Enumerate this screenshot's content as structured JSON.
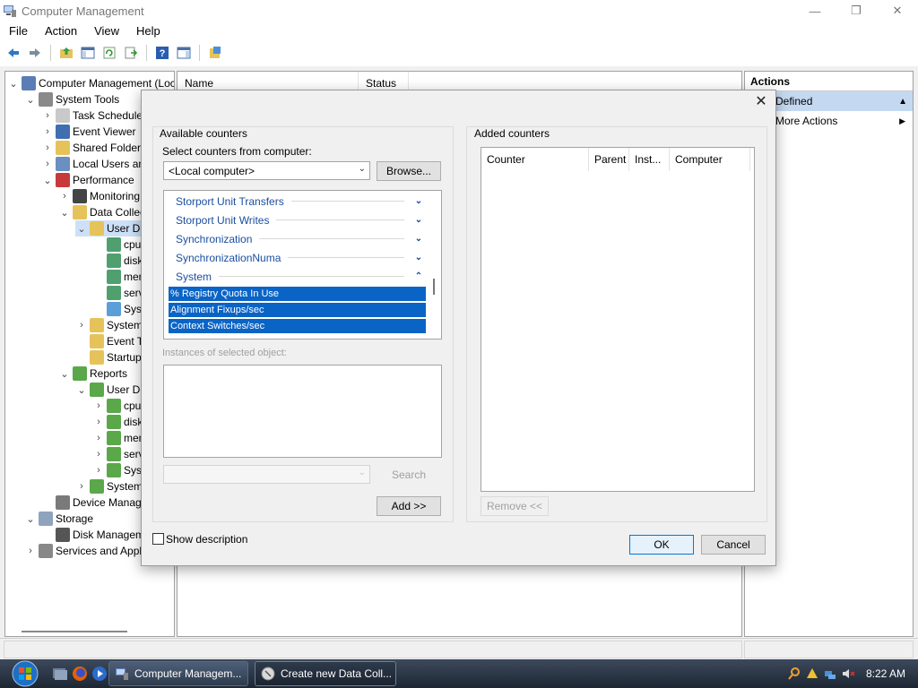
{
  "window": {
    "title": "Computer Management"
  },
  "menubar": [
    "File",
    "Action",
    "View",
    "Help"
  ],
  "toolbar": {
    "buttons": [
      "back-arrow-icon",
      "forward-arrow-icon",
      "up-folder-icon",
      "show-hide-console-tree-icon",
      "refresh-icon",
      "export-list-icon",
      "help-icon",
      "show-hide-action-pane-icon",
      "properties-icon"
    ]
  },
  "tree": {
    "items": [
      {
        "label": "Computer Management (Local",
        "icon": "computer-icon",
        "chevron": "down"
      },
      {
        "label": "System Tools",
        "icon": "tools-icon",
        "chevron": "down"
      },
      {
        "label": "Task Scheduler",
        "icon": "clock-icon",
        "chevron": "right"
      },
      {
        "label": "Event Viewer",
        "icon": "event-viewer-icon",
        "chevron": "right"
      },
      {
        "label": "Shared Folders",
        "icon": "shared-folder-icon",
        "chevron": "right"
      },
      {
        "label": "Local Users and G",
        "icon": "users-icon",
        "chevron": "right"
      },
      {
        "label": "Performance",
        "icon": "performance-icon",
        "chevron": "down"
      },
      {
        "label": "Monitoring To",
        "icon": "monitoring-icon",
        "chevron": "right"
      },
      {
        "label": "Data Collecto",
        "icon": "folder-icon",
        "chevron": "down"
      },
      {
        "label": "User Defin",
        "icon": "user-folder-icon",
        "chevron": "down",
        "selected": true
      },
      {
        "label": "cpu",
        "icon": "data-collector-set-icon",
        "chevron": ""
      },
      {
        "label": "disk",
        "icon": "data-collector-set-icon",
        "chevron": ""
      },
      {
        "label": "memo",
        "icon": "data-collector-set-icon",
        "chevron": ""
      },
      {
        "label": "server",
        "icon": "data-collector-set-icon",
        "chevron": ""
      },
      {
        "label": "System",
        "icon": "system-collector-icon",
        "chevron": ""
      },
      {
        "label": "System",
        "icon": "folder-icon",
        "chevron": "right"
      },
      {
        "label": "Event Trac",
        "icon": "folder-icon",
        "chevron": ""
      },
      {
        "label": "Startup Ev",
        "icon": "folder-icon",
        "chevron": ""
      },
      {
        "label": "Reports",
        "icon": "reports-icon",
        "chevron": "down"
      },
      {
        "label": "User Defin",
        "icon": "report-folder-icon",
        "chevron": "down"
      },
      {
        "label": "cpu",
        "icon": "report-icon",
        "chevron": "right"
      },
      {
        "label": "disk",
        "icon": "report-icon",
        "chevron": "right"
      },
      {
        "label": "memo",
        "icon": "report-icon",
        "chevron": "right"
      },
      {
        "label": "server",
        "icon": "report-icon",
        "chevron": "right"
      },
      {
        "label": "System",
        "icon": "report-icon",
        "chevron": "right"
      },
      {
        "label": "System",
        "icon": "report-folder-icon",
        "chevron": "right"
      },
      {
        "label": "Device Manager",
        "icon": "device-manager-icon",
        "chevron": ""
      },
      {
        "label": "Storage",
        "icon": "storage-icon",
        "chevron": "down"
      },
      {
        "label": "Disk Management",
        "icon": "disk-management-icon",
        "chevron": ""
      },
      {
        "label": "Services and Applica",
        "icon": "services-icon",
        "chevron": "right"
      }
    ]
  },
  "center": {
    "columns": [
      "Name",
      "Status"
    ]
  },
  "actions": {
    "title": "Actions",
    "section": "Defined",
    "items": [
      "More Actions"
    ]
  },
  "dialog": {
    "available_counters_label": "Available counters",
    "select_from_label": "Select counters from computer:",
    "computer_combo_value": "<Local computer>",
    "browse_button": "Browse...",
    "objects": [
      {
        "name": "Storport Unit Transfers",
        "expanded": false
      },
      {
        "name": "Storport Unit Writes",
        "expanded": false
      },
      {
        "name": "Synchronization",
        "expanded": false
      },
      {
        "name": "SynchronizationNuma",
        "expanded": false
      },
      {
        "name": "System",
        "expanded": true
      }
    ],
    "selected_counters": [
      "% Registry Quota In Use",
      "Alignment Fixups/sec",
      "Context Switches/sec"
    ],
    "instances_label": "Instances of selected object:",
    "search_button": "Search",
    "add_button": "Add >>",
    "added_counters_label": "Added counters",
    "added_columns": [
      "Counter",
      "Parent",
      "Inst...",
      "Computer"
    ],
    "remove_button": "Remove <<",
    "show_description_label": "Show description",
    "show_description_checked": false,
    "ok_button": "OK",
    "cancel_button": "Cancel"
  },
  "taskbar": {
    "buttons": [
      {
        "label": "Computer Managem...",
        "icon": "computer-management-icon",
        "active": false
      },
      {
        "label": "Create new Data Coll...",
        "icon": "data-collector-wizard-icon",
        "active": true
      }
    ],
    "clock": "8:22 AM"
  }
}
